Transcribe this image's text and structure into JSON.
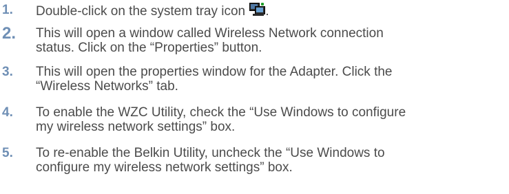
{
  "steps": [
    {
      "number": "1.",
      "text_before_icon": "Double-click on the system tray icon",
      "text_after_icon": "."
    },
    {
      "number": "2.",
      "line1": "This will open a window called Wireless Network connection",
      "line2": "status. Click on the “Properties” button."
    },
    {
      "number": "3.",
      "line1": "This will open the properties window for the Adapter. Click the",
      "line2": "“Wireless Networks” tab."
    },
    {
      "number": "4.",
      "line1": "To enable the WZC Utility, check the “Use Windows to configure",
      "line2": "my wireless network settings” box."
    },
    {
      "number": "5.",
      "line1": "To re-enable the Belkin Utility, uncheck the “Use Windows to",
      "line2": "configure my wireless network settings” box."
    }
  ],
  "icons": {
    "tray_icon": "network-connection-icon"
  },
  "colors": {
    "number": "#6f8fb5",
    "text": "#4b4b4b",
    "background": "#ffffff"
  }
}
